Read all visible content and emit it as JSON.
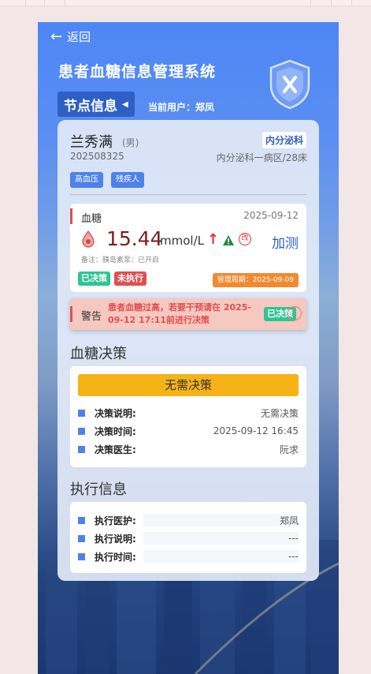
{
  "nav": {
    "back_label": "返回"
  },
  "header": {
    "title": "患者血糖信息管理系统",
    "node_label": "节点信息",
    "current_user": "当前用户：郑凤"
  },
  "patient": {
    "name": "兰秀满",
    "gender": "(男)",
    "id": "202508325",
    "department": "内分泌科",
    "ward": "内分泌科一病区/28床",
    "tags": [
      "高血压",
      "残疾人"
    ]
  },
  "glucose": {
    "label": "血糖",
    "date": "2025-09-12",
    "value": "15.44",
    "unit": "mmol/L",
    "trend": "↑",
    "modify_glyph": "改",
    "action": "加测",
    "note": "备注：胰岛素泵：已开启",
    "status_decided": "已决策",
    "status_unexecuted": "未执行",
    "period": "管理周期：2025-09-09"
  },
  "alert": {
    "label": "警告",
    "message": "患者血糖过高，若要干预请在 2025-09-12 17:11前进行决策",
    "status": "已决策",
    "info_glyph": "!"
  },
  "decision": {
    "section_title": "血糖决策",
    "result": "无需决策",
    "rows": [
      {
        "key": "决策说明:",
        "value": "无需决策"
      },
      {
        "key": "决策时间:",
        "value": "2025-09-12 16:45"
      },
      {
        "key": "决策医生:",
        "value": "阮求"
      }
    ]
  },
  "execution": {
    "section_title": "执行信息",
    "rows": [
      {
        "key": "执行医护:",
        "value": "郑凤"
      },
      {
        "key": "执行说明:",
        "value": "---"
      },
      {
        "key": "执行时间:",
        "value": "---"
      }
    ]
  },
  "colors": {
    "primary": "#4e82ea",
    "danger": "#e05050",
    "success": "#2ec592",
    "warning": "#f5b318",
    "orange": "#f08a30"
  }
}
